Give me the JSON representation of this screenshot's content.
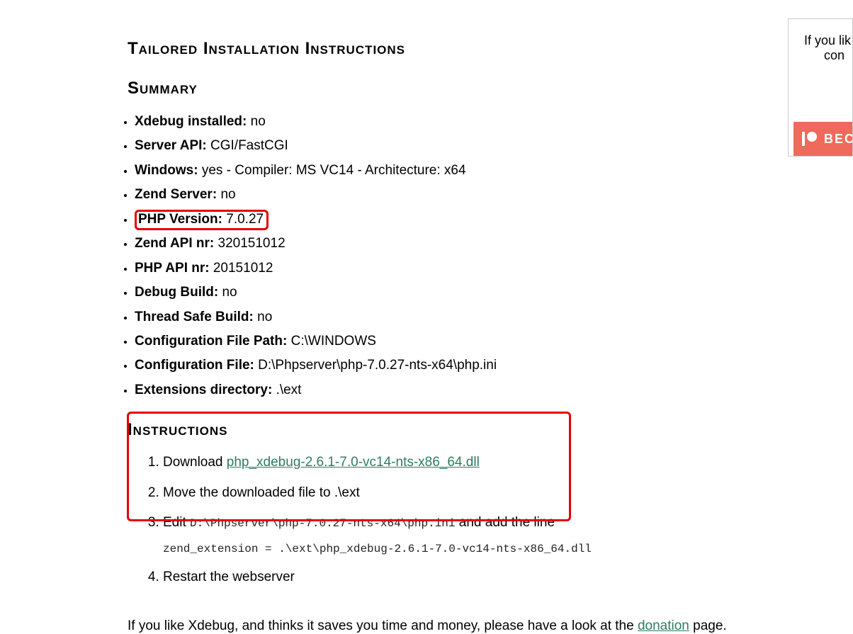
{
  "headings": {
    "main": "Tailored Installation Instructions",
    "summary": "Summary",
    "instructions": "Instructions"
  },
  "summary_items": [
    {
      "label": "Xdebug installed:",
      "value": "no",
      "highlighted": false
    },
    {
      "label": "Server API:",
      "value": "CGI/FastCGI",
      "highlighted": false
    },
    {
      "label": "Windows:",
      "value": "yes - Compiler: MS VC14 - Architecture: x64",
      "highlighted": false
    },
    {
      "label": "Zend Server:",
      "value": "no",
      "highlighted": false
    },
    {
      "label": "PHP Version:",
      "value": "7.0.27",
      "highlighted": true
    },
    {
      "label": "Zend API nr:",
      "value": "320151012",
      "highlighted": false
    },
    {
      "label": "PHP API nr:",
      "value": "20151012",
      "highlighted": false
    },
    {
      "label": "Debug Build:",
      "value": "no",
      "highlighted": false
    },
    {
      "label": "Thread Safe Build:",
      "value": "no",
      "highlighted": false
    },
    {
      "label": "Configuration File Path:",
      "value": "C:\\WINDOWS",
      "highlighted": false
    },
    {
      "label": "Configuration File:",
      "value": "D:\\Phpserver\\php-7.0.27-nts-x64\\php.ini",
      "highlighted": false
    },
    {
      "label": "Extensions directory:",
      "value": ".\\ext",
      "highlighted": false
    }
  ],
  "instructions": {
    "step1_prefix": "Download ",
    "step1_link": "php_xdebug-2.6.1-7.0-vc14-nts-x86_64.dll",
    "step2": "Move the downloaded file to .\\ext",
    "step3_prefix": "Edit ",
    "step3_path": "D:\\Phpserver\\php-7.0.27-nts-x64\\php.ini",
    "step3_suffix": " and add the line",
    "step3_code": "zend_extension = .\\ext\\php_xdebug-2.6.1-7.0-vc14-nts-x86_64.dll",
    "step4": "Restart the webserver"
  },
  "footer": {
    "prefix": "If you like Xdebug, and thinks it saves you time and money, please have a look at the ",
    "link": "donation",
    "suffix": " page."
  },
  "sidebar": {
    "text_line1": "If you lik",
    "text_line2": "con",
    "patreon_label": "BEC"
  }
}
